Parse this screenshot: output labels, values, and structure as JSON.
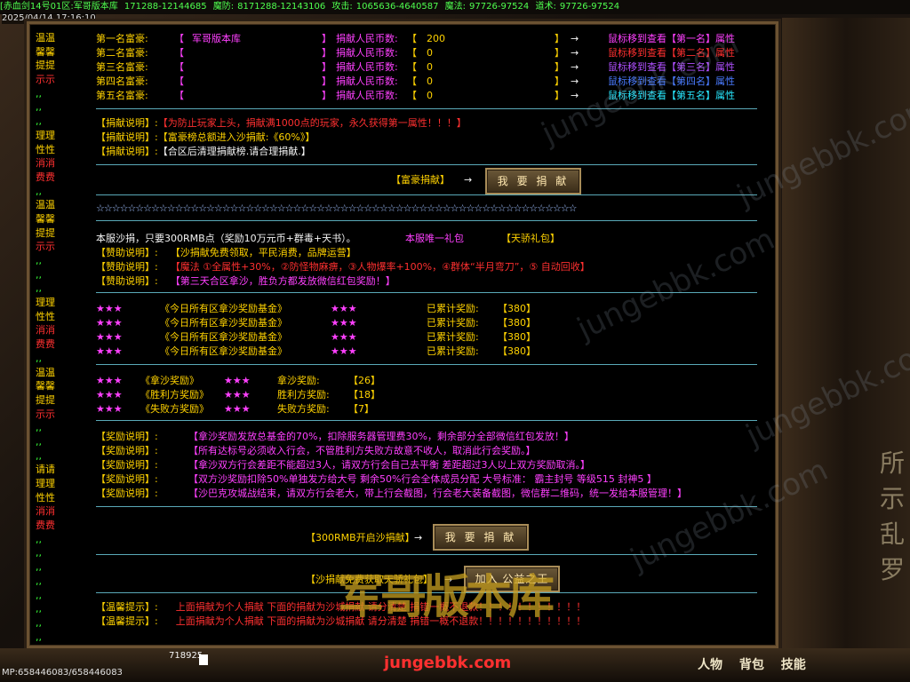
{
  "topbar": {
    "server": "[赤血剑14号01区:军哥版本库",
    "hp": "171288-12144685",
    "magic_def_label": "魔防:",
    "magic_def": "8171288-12143106",
    "attack_label": "攻击:",
    "attack": "1065636-4640587",
    "magic_label": "魔法:",
    "magic": "97726-97524",
    "tao_label": "道术:",
    "tao": "97726-97524"
  },
  "datetime": "2025/04/14 17:16:10",
  "side_labels": [
    "温温",
    "馨馨",
    "提提",
    "示示",
    ",,",
    ",,",
    ",,",
    "理理",
    "性性",
    "消消",
    "费费",
    ",,",
    "温温",
    "馨馨",
    "提提",
    "示示",
    ",,",
    ",,",
    ",,",
    "理理",
    "性性",
    "消消",
    "费费",
    ",,",
    "温温",
    "馨馨",
    "提提",
    "示示",
    ",,",
    ",,",
    ",,",
    "请请",
    "理理",
    "性性",
    "消消",
    "费费",
    ",,",
    ",,",
    ",,",
    ",,",
    ",,",
    ",,",
    ",,",
    ",,"
  ],
  "rich_list": [
    {
      "rank": "第一名富豪:",
      "name": "军哥版本库",
      "label": "捐献人民币数:",
      "amount": "200",
      "hint": "鼠标移到查看【第一名】属性"
    },
    {
      "rank": "第二名富豪:",
      "name": "",
      "label": "捐献人民币数:",
      "amount": "0",
      "hint": "鼠标移到查看【第二名】属性"
    },
    {
      "rank": "第三名富豪:",
      "name": "",
      "label": "捐献人民币数:",
      "amount": "0",
      "hint": "鼠标移到查看【第三名】属性"
    },
    {
      "rank": "第四名富豪:",
      "name": "",
      "label": "捐献人民币数:",
      "amount": "0",
      "hint": "鼠标移到查看【第四名】属性"
    },
    {
      "rank": "第五名富豪:",
      "name": "",
      "label": "捐献人民币数:",
      "amount": "0",
      "hint": "鼠标移到查看【第五名】属性"
    }
  ],
  "donate_notes": [
    {
      "label": "【捐献说明】:",
      "text": "【为防止玩家上头，捐献满1000点的玩家，永久获得第一属性！！！】"
    },
    {
      "label": "【捐献说明】:",
      "text": "【富豪榜总额进入沙捐献:《60%》】"
    },
    {
      "label": "【捐献说明】:",
      "text": "【合区后清理捐献榜.请合理捐献.】"
    }
  ],
  "rich_donate": {
    "label": "【富豪捐献】",
    "arrow": "→",
    "button": "我 要 捐 献"
  },
  "stars_line": "☆☆☆☆☆☆☆☆☆☆☆☆☆☆☆☆☆☆☆☆☆☆☆☆☆☆☆☆☆☆☆☆☆☆☆☆☆☆☆☆☆☆☆☆☆☆☆☆☆☆☆☆☆☆☆☆☆☆☆☆☆",
  "sabak": {
    "intro": "本服沙捐，只要300RMB点（奖励10万元币+群毒+天书）。",
    "unique": "本服唯一礼包",
    "gift": "【天骄礼包】",
    "notes": [
      {
        "label": "【赞助说明】:",
        "text": "【沙捐献免费领取，平民消费，品牌运营】"
      },
      {
        "label": "【赞助说明】:",
        "text": "【魔法 ①全属性+30%，②防怪物麻痹，③人物爆率+100%，④群体“半月弯刀”，⑤ 自动回收】"
      },
      {
        "label": "【赞助说明】:",
        "text": "【第三天合区拿沙，胜负方都发放微信红包奖励！】"
      }
    ]
  },
  "fund_rows": [
    {
      "stars": "★★★",
      "name": "《今日所有区拿沙奖励基金》",
      "stars2": "★★★",
      "label": "已累计奖励:",
      "value": "【380】"
    },
    {
      "stars": "★★★",
      "name": "《今日所有区拿沙奖励基金》",
      "stars2": "★★★",
      "label": "已累计奖励:",
      "value": "【380】"
    },
    {
      "stars": "★★★",
      "name": "《今日所有区拿沙奖励基金》",
      "stars2": "★★★",
      "label": "已累计奖励:",
      "value": "【380】"
    },
    {
      "stars": "★★★",
      "name": "《今日所有区拿沙奖励基金》",
      "stars2": "★★★",
      "label": "已累计奖励:",
      "value": "【380】"
    }
  ],
  "reward_rows": [
    {
      "stars": "★★★",
      "name": "《拿沙奖励》",
      "stars2": "★★★",
      "label": "拿沙奖励:",
      "value": "【26】"
    },
    {
      "stars": "★★★",
      "name": "《胜利方奖励》",
      "stars2": "★★★",
      "label": "胜利方奖励:",
      "value": "【18】"
    },
    {
      "stars": "★★★",
      "name": "《失败方奖励》",
      "stars2": "★★★",
      "label": "失败方奖励:",
      "value": "【7】"
    }
  ],
  "reward_notes": [
    {
      "label": "【奖励说明】:",
      "text": "【拿沙奖励发放总基金的70%，扣除服务器管理费30%，剩余部分全部微信红包发放！】"
    },
    {
      "label": "【奖励说明】:",
      "text": "【所有达标号必须收入行会，不管胜利方失败方故意不收人，取消此行会奖励。】"
    },
    {
      "label": "【奖励说明】:",
      "text": "【拿沙双方行会差距不能超过3人，请双方行会自己去平衡 差距超过3人以上双方奖励取消。】"
    },
    {
      "label": "【奖励说明】:",
      "text": "【双方沙奖励扣除50%单独发方给大号 剩余50%行会全体成员分配 大号标准： 霸主封号   等级515   封神5 】"
    },
    {
      "label": "【奖励说明】:",
      "text": "【沙巴克攻城战结束，请双方行会老大，带上行会截图，行会老大装备截图，微信群二维码，统一发给本服管理！】"
    }
  ],
  "sabak_donate": {
    "label": "【300RMB开启沙捐献】",
    "arrow": "→",
    "button": "我 要 捐 献"
  },
  "guild": {
    "label": "【沙捐献免费获取天骄礼包】",
    "arrow": "→",
    "button": "加入 公益之王"
  },
  "tips": [
    {
      "label": "【温馨提示】:",
      "text": "上面捐献为个人捐献  下面的捐献为沙城捐献  请分清楚  捐错一概不退款！！！！！！！！！！！"
    },
    {
      "label": "【温馨提示】:",
      "text": "上面捐献为个人捐献  下面的捐献为沙城捐献  请分清楚  捐错一概不退款！！！！！！！！！！！"
    }
  ],
  "watermark": "jungebbk.com",
  "logo": "军哥版本库",
  "bottom": {
    "mp": "MP:658446083/658446083",
    "left_num": "718925",
    "skills": [
      "人物",
      "背包",
      "技能"
    ]
  },
  "frame_glyphs": [
    "所",
    "示",
    "乱",
    "罗"
  ]
}
